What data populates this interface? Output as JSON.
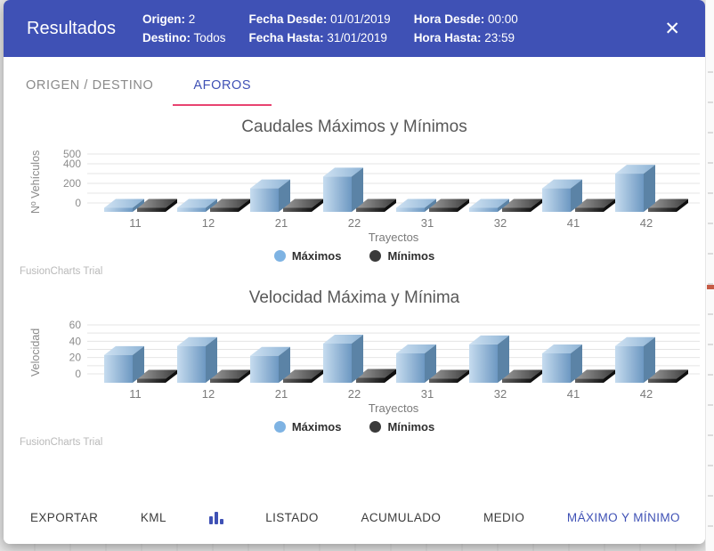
{
  "header": {
    "title": "Resultados",
    "close_icon": "✕",
    "bg_color": "#3f51b5",
    "meta": [
      {
        "rows": [
          {
            "label": "Origen:",
            "value": "2"
          },
          {
            "label": "Destino:",
            "value": "Todos"
          }
        ]
      },
      {
        "rows": [
          {
            "label": "Fecha Desde:",
            "value": "01/01/2019"
          },
          {
            "label": "Fecha Hasta:",
            "value": "31/01/2019"
          }
        ]
      },
      {
        "rows": [
          {
            "label": "Hora Desde:",
            "value": "00:00"
          },
          {
            "label": "Hora Hasta:",
            "value": "23:59"
          }
        ]
      }
    ]
  },
  "tabs": [
    {
      "label": "ORIGEN / DESTINO",
      "active": false
    },
    {
      "label": "AFOROS",
      "active": true
    }
  ],
  "accent_blue": "#3f51b5",
  "accent_pink": "#e84370",
  "watermark": "FusionCharts Trial",
  "chart_data": [
    {
      "type": "bar",
      "title": "Caudales Máximos y Mínimos",
      "xlabel": "Trayectos",
      "ylabel": "Nº Vehículos",
      "categories": [
        "11",
        "12",
        "21",
        "22",
        "31",
        "32",
        "41",
        "42"
      ],
      "series": [
        {
          "name": "Máximos",
          "values": [
            30,
            35,
            240,
            360,
            20,
            30,
            240,
            390
          ]
        },
        {
          "name": "Mínimos",
          "values": [
            5,
            5,
            5,
            5,
            5,
            5,
            5,
            5
          ]
        }
      ],
      "colors": [
        "#7eb3e3",
        "#3a3a3a"
      ],
      "ylim": [
        0,
        500
      ],
      "yticks": [
        0,
        200,
        400,
        500
      ],
      "grid_step": 100,
      "grid": true,
      "legend_position": "bottom"
    },
    {
      "type": "bar",
      "title": "Velocidad Máxima y Mínima",
      "xlabel": "Trayectos",
      "ylabel": "Velocidad",
      "categories": [
        "11",
        "12",
        "21",
        "22",
        "31",
        "32",
        "41",
        "42"
      ],
      "series": [
        {
          "name": "Máximos",
          "values": [
            34,
            45,
            33,
            48,
            36,
            47,
            36,
            45
          ]
        },
        {
          "name": "Mínimos",
          "values": [
            3,
            3,
            5,
            6,
            3,
            3,
            5,
            5
          ]
        }
      ],
      "colors": [
        "#7eb3e3",
        "#3a3a3a"
      ],
      "ylim": [
        0,
        60
      ],
      "yticks": [
        0,
        20,
        40,
        60
      ],
      "grid_step": 10,
      "grid": true,
      "legend_position": "bottom"
    }
  ],
  "toolbar": {
    "items": [
      "EXPORTAR",
      "KML",
      "LISTADO",
      "ACUMULADO",
      "MEDIO",
      "MÁXIMO Y MÍNIMO"
    ],
    "active_item": "MÁXIMO Y MÍNIMO",
    "chart_icon": "bar-chart"
  }
}
